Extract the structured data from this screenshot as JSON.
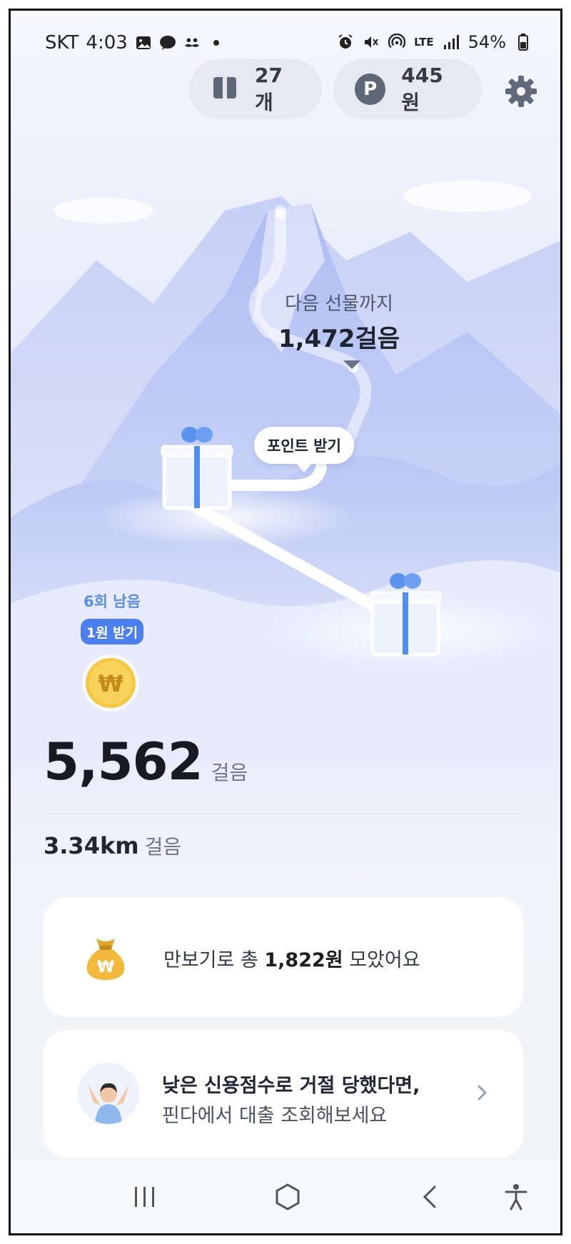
{
  "status_bar": {
    "carrier": "SKT",
    "time": "4:03",
    "battery": "54%",
    "network": "LTE"
  },
  "header": {
    "gift_count": "27개",
    "points": "445원",
    "points_symbol": "P"
  },
  "scene": {
    "next_gift_label": "다음 선물까지",
    "next_gift_steps": "1,472걸음",
    "points_bubble": "포인트 받기",
    "remaining_label": "6회 남음",
    "reward_button": "1원 받기",
    "coin_symbol": "₩"
  },
  "stats": {
    "steps_value": "5,562",
    "steps_unit": "걸음",
    "distance_value": "3.34km",
    "distance_unit": "걸음"
  },
  "total_card": {
    "prefix": "만보기로 총 ",
    "amount": "1,822원",
    "suffix": " 모았어요"
  },
  "ad_card": {
    "line1": "낮은 신용점수로 거절 당했다면,",
    "line2": "핀다에서 대출 조회해보세요"
  },
  "colors": {
    "accent": "#4b7ff0",
    "coin": "#f5c842",
    "gift_ribbon": "#4f8df0"
  }
}
